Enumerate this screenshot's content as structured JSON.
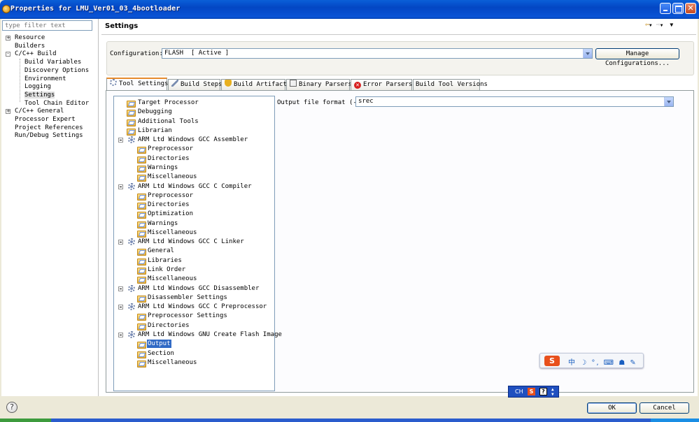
{
  "window": {
    "title": "Properties for LMU_Ver01_03_4bootloader"
  },
  "filter": {
    "placeholder": "type filter text"
  },
  "left_tree": [
    {
      "label": "Resource",
      "expander": "+",
      "indent": 0
    },
    {
      "label": "Builders",
      "expander": "",
      "indent": 0
    },
    {
      "label": "C/C++ Build",
      "expander": "-",
      "indent": 0
    },
    {
      "label": "Build Variables",
      "expander": "",
      "indent": 1
    },
    {
      "label": "Discovery Options",
      "expander": "",
      "indent": 1
    },
    {
      "label": "Environment",
      "expander": "",
      "indent": 1
    },
    {
      "label": "Logging",
      "expander": "",
      "indent": 1
    },
    {
      "label": "Settings",
      "expander": "",
      "indent": 1,
      "selected": true
    },
    {
      "label": "Tool Chain Editor",
      "expander": "",
      "indent": 1
    },
    {
      "label": "C/C++ General",
      "expander": "+",
      "indent": 0
    },
    {
      "label": "Processor Expert",
      "expander": "",
      "indent": 0
    },
    {
      "label": "Project References",
      "expander": "",
      "indent": 0
    },
    {
      "label": "Run/Debug Settings",
      "expander": "",
      "indent": 0
    }
  ],
  "page": {
    "title": "Settings"
  },
  "configuration": {
    "label": "Configuration:",
    "value": "FLASH  [ Active ]",
    "manage_button": "Manage Configurations..."
  },
  "tabs": [
    {
      "label": "Tool Settings",
      "icon": "gear-icon",
      "active": true
    },
    {
      "label": "Build Steps",
      "icon": "wrench-icon"
    },
    {
      "label": "Build Artifact",
      "icon": "trophy-icon"
    },
    {
      "label": "Binary Parsers",
      "icon": "binary-icon"
    },
    {
      "label": "Error Parsers",
      "icon": "error-icon"
    },
    {
      "label": "Build Tool Versions",
      "icon": ""
    }
  ],
  "tool_tree": [
    {
      "label": "Target Processor",
      "type": "folder",
      "level": 0
    },
    {
      "label": "Debugging",
      "type": "folder",
      "level": 0
    },
    {
      "label": "Additional Tools",
      "type": "folder",
      "level": 0
    },
    {
      "label": "Librarian",
      "type": "folder",
      "level": 0
    },
    {
      "label": "ARM Ltd Windows GCC Assembler",
      "type": "tool",
      "level": 0
    },
    {
      "label": "Preprocessor",
      "type": "folder",
      "level": 1
    },
    {
      "label": "Directories",
      "type": "folder",
      "level": 1
    },
    {
      "label": "Warnings",
      "type": "folder",
      "level": 1
    },
    {
      "label": "Miscellaneous",
      "type": "folder",
      "level": 1
    },
    {
      "label": "ARM Ltd Windows GCC C Compiler",
      "type": "tool",
      "level": 0
    },
    {
      "label": "Preprocessor",
      "type": "folder",
      "level": 1
    },
    {
      "label": "Directories",
      "type": "folder",
      "level": 1
    },
    {
      "label": "Optimization",
      "type": "folder",
      "level": 1
    },
    {
      "label": "Warnings",
      "type": "folder",
      "level": 1
    },
    {
      "label": "Miscellaneous",
      "type": "folder",
      "level": 1
    },
    {
      "label": "ARM Ltd Windows GCC C Linker",
      "type": "tool",
      "level": 0
    },
    {
      "label": "General",
      "type": "folder",
      "level": 1
    },
    {
      "label": "Libraries",
      "type": "folder",
      "level": 1
    },
    {
      "label": "Link Order",
      "type": "folder",
      "level": 1
    },
    {
      "label": "Miscellaneous",
      "type": "folder",
      "level": 1
    },
    {
      "label": "ARM Ltd Windows GCC Disassembler",
      "type": "tool",
      "level": 0
    },
    {
      "label": "Disassembler Settings",
      "type": "folder",
      "level": 1
    },
    {
      "label": "ARM Ltd Windows GCC C Preprocessor",
      "type": "tool",
      "level": 0
    },
    {
      "label": "Preprocessor Settings",
      "type": "folder",
      "level": 1
    },
    {
      "label": "Directories",
      "type": "folder",
      "level": 1
    },
    {
      "label": "ARM Ltd Windows GNU Create Flash Image",
      "type": "tool",
      "level": 0
    },
    {
      "label": "Output",
      "type": "folder",
      "level": 1,
      "selected": true
    },
    {
      "label": "Section",
      "type": "folder",
      "level": 1
    },
    {
      "label": "Miscellaneous",
      "type": "folder",
      "level": 1
    }
  ],
  "option": {
    "label": "Output file format (-O)",
    "value": "srec"
  },
  "ime": {
    "logo": "S",
    "items": "中 ☽ °, ⌨ ☗ ✎",
    "mini_ch": "CH",
    "mini_s": "S",
    "mini_help": "?"
  },
  "buttons": {
    "help": "?",
    "ok": "OK",
    "cancel": "Cancel"
  }
}
